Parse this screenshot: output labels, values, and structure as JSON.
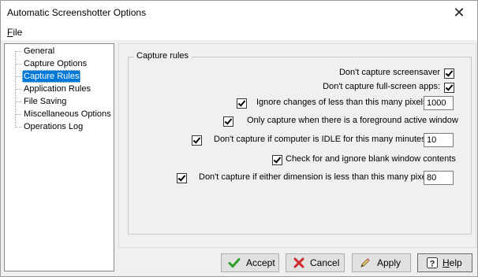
{
  "window": {
    "title": "Automatic Screenshotter Options",
    "close_glyph": "✕"
  },
  "menu": {
    "file_ul": "F",
    "file_rest": "ile"
  },
  "nav": {
    "items": [
      {
        "label": "General"
      },
      {
        "label": "Capture Options"
      },
      {
        "label": "Capture Rules",
        "selected": true
      },
      {
        "label": "Application Rules"
      },
      {
        "label": "File Saving"
      },
      {
        "label": "Miscellaneous Options"
      },
      {
        "label": "Operations Log"
      }
    ]
  },
  "capture_rules": {
    "group_title": "Capture rules",
    "dont_capture_screensaver": {
      "label": "Don't capture screensaver",
      "checked": true
    },
    "dont_capture_fullscreen": {
      "label": "Don't capture full-screen apps:",
      "checked": true
    },
    "ignore_changes": {
      "label": "Ignore changes of less than this many pixels:",
      "checked": true,
      "value": "1000"
    },
    "foreground_only": {
      "label": "Only capture when there is a foreground active window",
      "checked": true
    },
    "idle": {
      "label": "Don't capture if computer is IDLE for this many minutes:",
      "checked": true,
      "value": "10"
    },
    "blank_window": {
      "label": "Check for and ignore blank window contents",
      "checked": true
    },
    "min_dimension": {
      "label": "Don't capture if either dimension is less than this many pixels",
      "checked": true,
      "value": "80"
    }
  },
  "buttons": {
    "accept": "Accept",
    "cancel": "Cancel",
    "apply": "Apply",
    "help_ul": "H",
    "help_rest": "elp"
  },
  "icons": {
    "accept": "checkmark-icon",
    "cancel": "x-icon",
    "apply": "pencil-icon",
    "help": "question-icon"
  },
  "colors": {
    "selection": "#0078d7",
    "accept_green": "#2aa02a",
    "cancel_red": "#d22a2a"
  }
}
